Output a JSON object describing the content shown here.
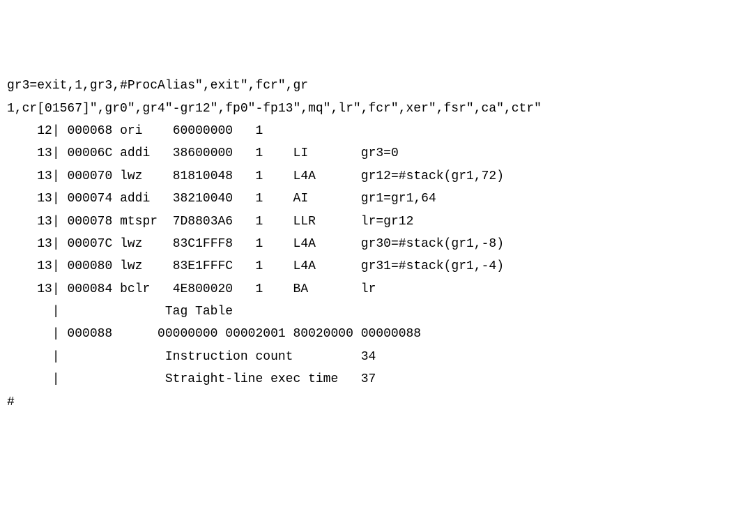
{
  "header": {
    "line1": "gr3=exit,1,gr3,#ProcAlias\",exit\",fcr\",gr",
    "line2": "1,cr[01567]\",gr0\",gr4\"-gr12\",fp0\"-fp13\",mq\",lr\",fcr\",xer\",fsr\",ca\",ctr\""
  },
  "rows": [
    {
      "num": "12",
      "addr": "000068",
      "mnem": "ori",
      "hex": "60000000",
      "op": "1",
      "tag": "",
      "desc": ""
    },
    {
      "num": "13",
      "addr": "00006C",
      "mnem": "addi",
      "hex": "38600000",
      "op": "1",
      "tag": "LI",
      "desc": "gr3=0"
    },
    {
      "num": "13",
      "addr": "000070",
      "mnem": "lwz",
      "hex": "81810048",
      "op": "1",
      "tag": "L4A",
      "desc": "gr12=#stack(gr1,72)"
    },
    {
      "num": "13",
      "addr": "000074",
      "mnem": "addi",
      "hex": "38210040",
      "op": "1",
      "tag": "AI",
      "desc": "gr1=gr1,64"
    },
    {
      "num": "13",
      "addr": "000078",
      "mnem": "mtspr",
      "hex": "7D8803A6",
      "op": "1",
      "tag": "LLR",
      "desc": "lr=gr12"
    },
    {
      "num": "13",
      "addr": "00007C",
      "mnem": "lwz",
      "hex": "83C1FFF8",
      "op": "1",
      "tag": "L4A",
      "desc": "gr30=#stack(gr1,-8)"
    },
    {
      "num": "13",
      "addr": "000080",
      "mnem": "lwz",
      "hex": "83E1FFFC",
      "op": "1",
      "tag": "L4A",
      "desc": "gr31=#stack(gr1,-4)"
    },
    {
      "num": "13",
      "addr": "000084",
      "mnem": "bclr",
      "hex": "4E800020",
      "op": "1",
      "tag": "BA",
      "desc": "lr"
    }
  ],
  "footer": {
    "tagTableLabel": "Tag Table",
    "tagAddr": "000088",
    "tagData": "00000000 00002001 80020000 00000088",
    "instrCountLabel": "Instruction count",
    "instrCountValue": "34",
    "execTimeLabel": "Straight-line exec time",
    "execTimeValue": "37"
  },
  "prompt": "#"
}
